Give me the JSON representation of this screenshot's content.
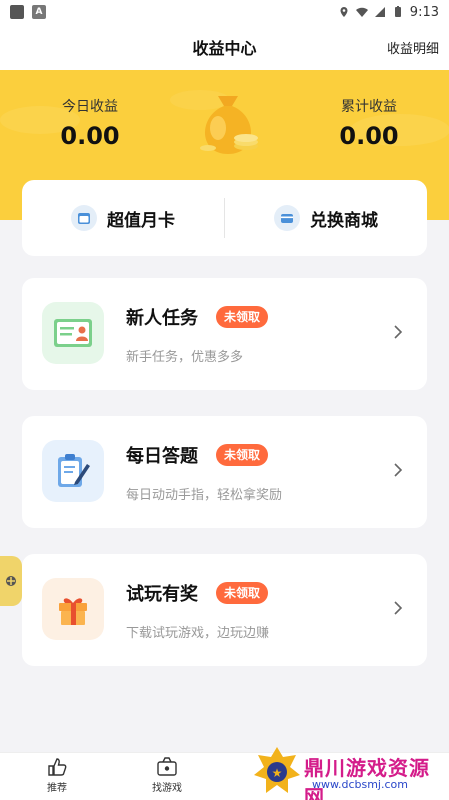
{
  "status_bar": {
    "time": "9:13"
  },
  "header": {
    "title": "收益中心",
    "right_link": "收益明细"
  },
  "summary": {
    "today_label": "今日收益",
    "today_value": "0.00",
    "total_label": "累计收益",
    "total_value": "0.00"
  },
  "quick_actions": {
    "monthly_card": "超值月卡",
    "exchange_store": "兑换商城"
  },
  "tasks": [
    {
      "title": "新人任务",
      "badge": "未领取",
      "subtitle": "新手任务，优惠多多",
      "icon": "id-card-icon"
    },
    {
      "title": "每日答题",
      "badge": "未领取",
      "subtitle": "每日动动手指，轻松拿奖励",
      "icon": "clipboard-pen-icon"
    },
    {
      "title": "试玩有奖",
      "badge": "未领取",
      "subtitle": "下载试玩游戏，边玩边赚",
      "icon": "gift-icon"
    }
  ],
  "bottom_tabs": [
    {
      "label": "推荐",
      "icon": "thumb-up-icon"
    },
    {
      "label": "找游戏",
      "icon": "game-box-icon"
    }
  ],
  "watermark": {
    "text": "鼎川游戏资源网",
    "url": "www.dcbsmj.com"
  },
  "colors": {
    "hero": "#fbcf3d",
    "badge": "#ff6a3d",
    "background": "#f3f3f6"
  }
}
